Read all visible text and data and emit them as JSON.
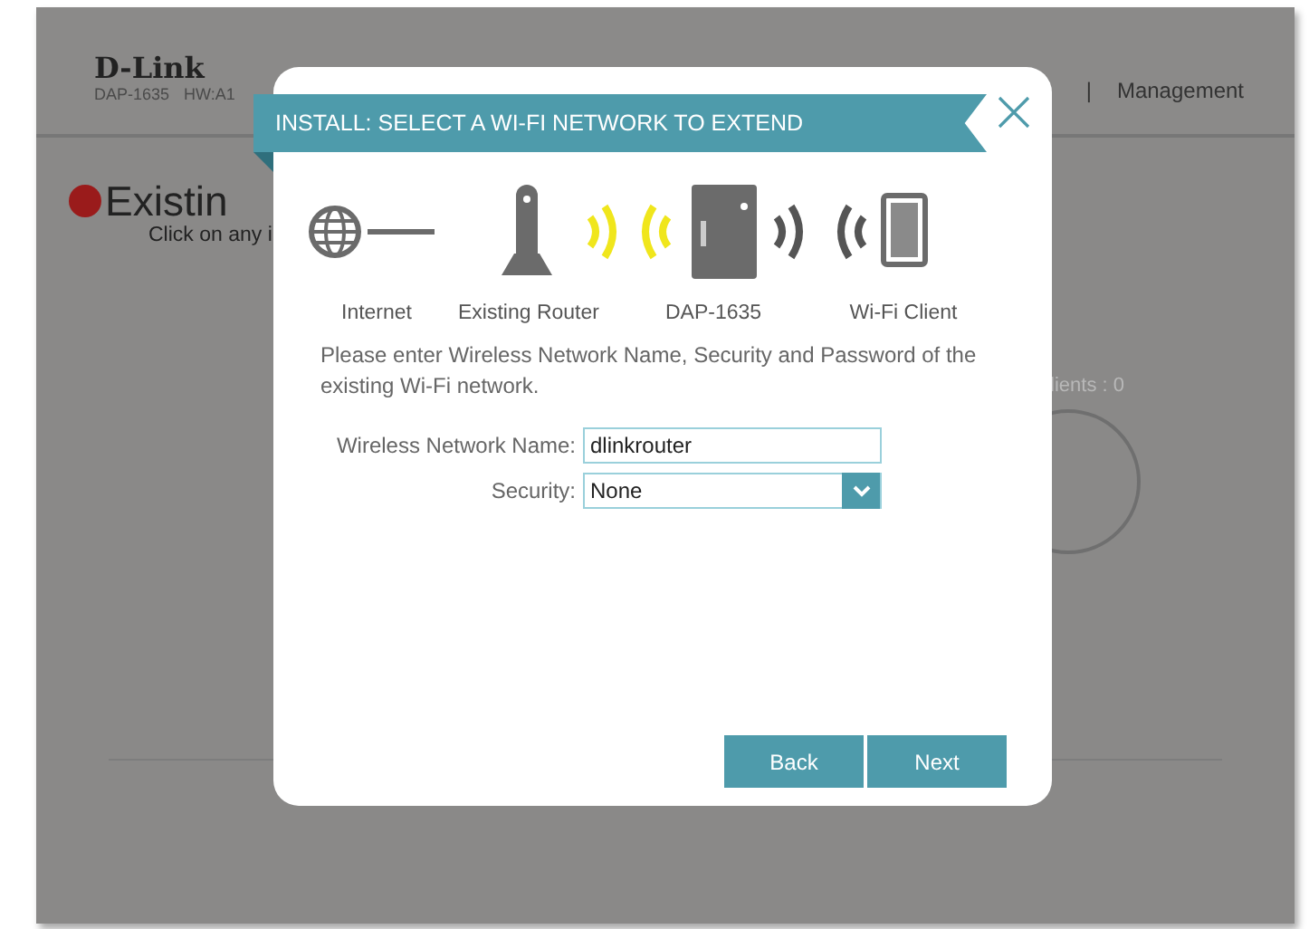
{
  "header": {
    "logo": "D-Link",
    "model": "DAP-1635",
    "hardware": "HW:A1",
    "separator": "|",
    "nav_item": "Management"
  },
  "status": {
    "title": "Existin",
    "hint": "Click on any i",
    "clients": "lients : 0"
  },
  "dialog": {
    "title": "INSTALL: SELECT A WI-FI NETWORK TO EXTEND",
    "diagram": [
      {
        "kind": "globe",
        "label": "Internet"
      },
      {
        "kind": "router",
        "label": "Existing Router"
      },
      {
        "kind": "extender",
        "label": "DAP-1635"
      },
      {
        "kind": "client",
        "label": "Wi-Fi Client"
      }
    ],
    "instructions": "Please enter Wireless Network Name, Security and Password of the existing Wi-Fi network.",
    "fields": [
      {
        "kind": "text",
        "label": "Wireless Network Name:",
        "value": "dlinkrouter"
      },
      {
        "kind": "select",
        "label": "Security:",
        "value": "None"
      }
    ],
    "buttons": [
      "Back",
      "Next"
    ]
  }
}
